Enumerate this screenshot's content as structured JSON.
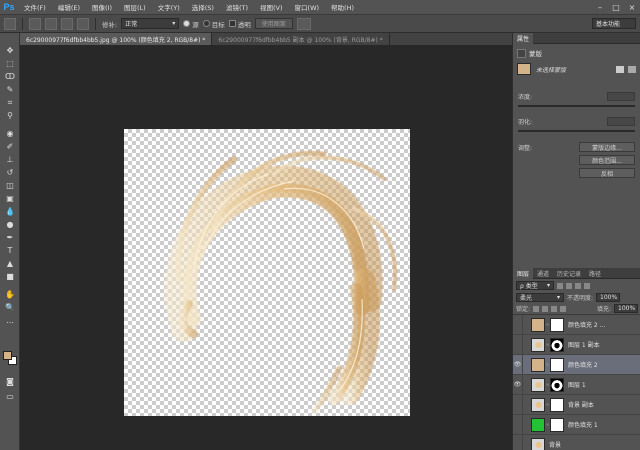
{
  "app": {
    "logo": "Ps"
  },
  "menu": [
    "文件(F)",
    "编辑(E)",
    "图像(I)",
    "图层(L)",
    "文字(Y)",
    "选择(S)",
    "滤镜(T)",
    "视图(V)",
    "窗口(W)",
    "帮助(H)"
  ],
  "window_controls": [
    "–",
    "□",
    "×"
  ],
  "options": {
    "feather_label": "修补:",
    "mode_value": "正常",
    "source_label": "源",
    "target_label": "目标",
    "transparent_label": "透明",
    "use_pattern_label": "使用图案",
    "workspace": "基本功能"
  },
  "tabs": [
    {
      "label": "6c29000977f6dfbb4bb5.jpg @ 100% (颜色填充 2, RGB/8#) *",
      "active": true
    },
    {
      "label": "6c29000977f6dfbb4bb5 副本 @ 100% (背景, RGB/8#) *",
      "active": false
    }
  ],
  "properties": {
    "tab_label": "属性",
    "header": "蒙版",
    "subtitle": "未选择蒙版",
    "density_label": "浓度:",
    "feather_label": "羽化:",
    "adjust_label": "调整:",
    "btn_edge": "蒙版边缘...",
    "btn_color_range": "颜色范围...",
    "btn_invert": "反相"
  },
  "layers_panel": {
    "tabs": [
      "图层",
      "通道",
      "历史记录",
      "路径"
    ],
    "filter_label": "ρ 类型",
    "blend_mode": "柔光",
    "opacity_label": "不透明度:",
    "opacity_value": "100%",
    "lock_label": "锁定:",
    "fill_label": "填充:",
    "fill_value": "100%",
    "layers": [
      {
        "name": "颜色填充 2 ...",
        "visible": false,
        "thumb": "#d5b38a",
        "mask": "white",
        "selected": false
      },
      {
        "name": "图层 1 副本",
        "visible": false,
        "thumb": "hair",
        "mask": "hair-mask",
        "selected": false
      },
      {
        "name": "颜色填充 2",
        "visible": true,
        "thumb": "#d5b38a",
        "mask": "white",
        "selected": true
      },
      {
        "name": "图层 1",
        "visible": true,
        "thumb": "hair",
        "mask": "hair-mask",
        "selected": false
      },
      {
        "name": "背景 副本",
        "visible": false,
        "thumb": "hair",
        "mask": "white",
        "selected": false
      },
      {
        "name": "颜色填充 1",
        "visible": false,
        "thumb": "#22c436",
        "mask": "white",
        "selected": false
      },
      {
        "name": "背景",
        "visible": false,
        "thumb": "hair",
        "mask": "none",
        "selected": false
      }
    ]
  },
  "colors": {
    "foreground": "#d5b38a",
    "background": "#ffffff",
    "accent": "#31a8ff"
  }
}
